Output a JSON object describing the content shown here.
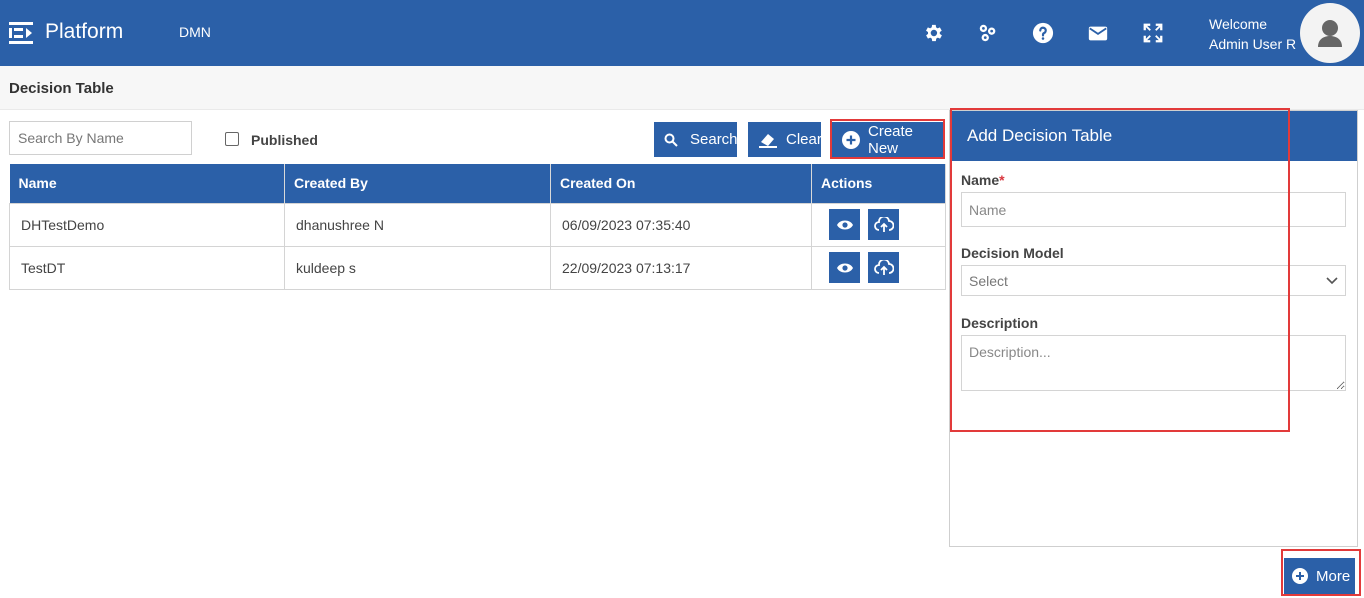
{
  "header": {
    "brand": "Platform",
    "module": "DMN",
    "welcome": "Welcome",
    "user": "Admin User R",
    "icons": [
      "settings-icon",
      "modules-icon",
      "help-icon",
      "mail-icon",
      "fullscreen-icon"
    ]
  },
  "page": {
    "title": "Decision Table"
  },
  "toolbar": {
    "search_placeholder": "Search By Name",
    "published_label": "Published",
    "search_label": "Search",
    "clear_label": "Clear",
    "create_label": "Create New"
  },
  "table": {
    "columns": [
      "Name",
      "Created By",
      "Created On",
      "Actions"
    ],
    "rows": [
      {
        "name": "DHTestDemo",
        "created_by": "dhanushree N",
        "created_on": "06/09/2023 07:35:40"
      },
      {
        "name": "TestDT",
        "created_by": "kuldeep s",
        "created_on": "22/09/2023 07:13:17"
      }
    ]
  },
  "panel": {
    "title": "Add Decision Table",
    "name_label": "Name",
    "required_mark": "*",
    "name_placeholder": "Name",
    "model_label": "Decision Model",
    "model_selected": "Select",
    "description_label": "Description",
    "description_placeholder": "Description..."
  },
  "more_label": "More",
  "colors": {
    "primary": "#2b60a8",
    "highlight": "#e23a3a"
  }
}
